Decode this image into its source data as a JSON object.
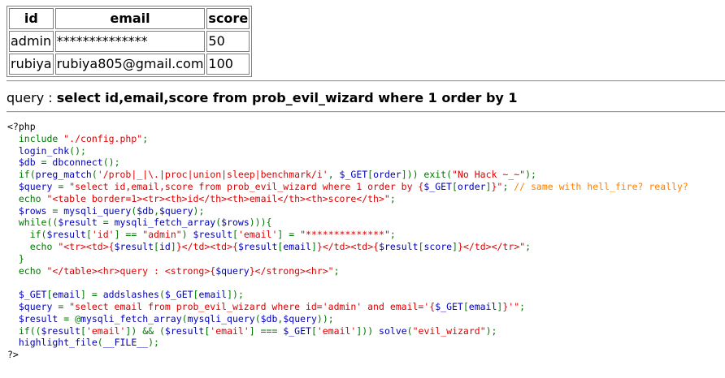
{
  "table": {
    "headers": [
      "id",
      "email",
      "score"
    ],
    "rows": [
      [
        "admin",
        "**************",
        "50"
      ],
      [
        "rubiya",
        "rubiya805@gmail.com",
        "100"
      ]
    ]
  },
  "query": {
    "label": "query : ",
    "text": "select id,email,score from prob_evil_wizard where 1 order by 1"
  },
  "colors": {
    "default": "#0000BB",
    "keyword": "#007700",
    "string": "#DD0000",
    "comment": "#FF8000",
    "html": "#000000"
  },
  "source_lines": [
    [
      [
        "html",
        "<?php"
      ]
    ],
    [
      [
        "default",
        "  "
      ],
      [
        "kw",
        "include "
      ],
      [
        "str",
        "\"./config.php\""
      ],
      [
        "kw",
        ";"
      ]
    ],
    [
      [
        "default",
        "  login_chk"
      ],
      [
        "kw",
        "();"
      ]
    ],
    [
      [
        "default",
        "  $db "
      ],
      [
        "kw",
        "= "
      ],
      [
        "default",
        "dbconnect"
      ],
      [
        "kw",
        "();"
      ]
    ],
    [
      [
        "kw",
        "  if("
      ],
      [
        "default",
        "preg_match"
      ],
      [
        "kw",
        "("
      ],
      [
        "str",
        "'/prob|_|\\.|proc|union|sleep|benchmark/i'"
      ],
      [
        "kw",
        ", "
      ],
      [
        "default",
        "$_GET"
      ],
      [
        "kw",
        "["
      ],
      [
        "default",
        "order"
      ],
      [
        "kw",
        "])) exit("
      ],
      [
        "str",
        "\"No Hack ~_~\""
      ],
      [
        "kw",
        ");"
      ]
    ],
    [
      [
        "default",
        "  $query "
      ],
      [
        "kw",
        "= "
      ],
      [
        "str",
        "\"select id,email,score from prob_evil_wizard where 1 order by {"
      ],
      [
        "default",
        "$_GET"
      ],
      [
        "kw",
        "["
      ],
      [
        "default",
        "order"
      ],
      [
        "kw",
        "]"
      ],
      [
        "str",
        "}\""
      ],
      [
        "kw",
        "; "
      ],
      [
        "cmt",
        "// same with hell_fire? really?"
      ]
    ],
    [
      [
        "kw",
        "  echo "
      ],
      [
        "str",
        "\"<table border=1><tr><th>id</th><th>email</th><th>score</th>\""
      ],
      [
        "kw",
        ";"
      ]
    ],
    [
      [
        "default",
        "  $rows "
      ],
      [
        "kw",
        "= "
      ],
      [
        "default",
        "mysqli_query"
      ],
      [
        "kw",
        "("
      ],
      [
        "default",
        "$db"
      ],
      [
        "kw",
        ","
      ],
      [
        "default",
        "$query"
      ],
      [
        "kw",
        ");"
      ]
    ],
    [
      [
        "kw",
        "  while(("
      ],
      [
        "default",
        "$result "
      ],
      [
        "kw",
        "= "
      ],
      [
        "default",
        "mysqli_fetch_array"
      ],
      [
        "kw",
        "("
      ],
      [
        "default",
        "$rows"
      ],
      [
        "kw",
        "))){"
      ]
    ],
    [
      [
        "kw",
        "    if("
      ],
      [
        "default",
        "$result"
      ],
      [
        "kw",
        "["
      ],
      [
        "str",
        "'id'"
      ],
      [
        "kw",
        "] == "
      ],
      [
        "str",
        "\"admin\""
      ],
      [
        "kw",
        ") "
      ],
      [
        "default",
        "$result"
      ],
      [
        "kw",
        "["
      ],
      [
        "str",
        "'email'"
      ],
      [
        "kw",
        "] = "
      ],
      [
        "str",
        "\"**************\""
      ],
      [
        "kw",
        ";"
      ]
    ],
    [
      [
        "kw",
        "    echo "
      ],
      [
        "str",
        "\"<tr><td>{"
      ],
      [
        "default",
        "$result"
      ],
      [
        "kw",
        "["
      ],
      [
        "default",
        "id"
      ],
      [
        "kw",
        "]"
      ],
      [
        "str",
        "}</td><td>{"
      ],
      [
        "default",
        "$result"
      ],
      [
        "kw",
        "["
      ],
      [
        "default",
        "email"
      ],
      [
        "kw",
        "]"
      ],
      [
        "str",
        "}</td><td>{"
      ],
      [
        "default",
        "$result"
      ],
      [
        "kw",
        "["
      ],
      [
        "default",
        "score"
      ],
      [
        "kw",
        "]"
      ],
      [
        "str",
        "}</td></tr>\""
      ],
      [
        "kw",
        ";"
      ]
    ],
    [
      [
        "kw",
        "  }"
      ]
    ],
    [
      [
        "kw",
        "  echo "
      ],
      [
        "str",
        "\"</table><hr>query : <strong>{"
      ],
      [
        "default",
        "$query"
      ],
      [
        "str",
        "}</strong><hr>\""
      ],
      [
        "kw",
        ";"
      ]
    ],
    [
      [
        "default",
        " "
      ]
    ],
    [
      [
        "default",
        "  $_GET"
      ],
      [
        "kw",
        "["
      ],
      [
        "default",
        "email"
      ],
      [
        "kw",
        "] = "
      ],
      [
        "default",
        "addslashes"
      ],
      [
        "kw",
        "("
      ],
      [
        "default",
        "$_GET"
      ],
      [
        "kw",
        "["
      ],
      [
        "default",
        "email"
      ],
      [
        "kw",
        "]);"
      ]
    ],
    [
      [
        "default",
        "  $query "
      ],
      [
        "kw",
        "= "
      ],
      [
        "str",
        "\"select email from prob_evil_wizard where id='admin' and email='{"
      ],
      [
        "default",
        "$_GET"
      ],
      [
        "kw",
        "["
      ],
      [
        "default",
        "email"
      ],
      [
        "kw",
        "]"
      ],
      [
        "str",
        "}'\""
      ],
      [
        "kw",
        ";"
      ]
    ],
    [
      [
        "default",
        "  $result "
      ],
      [
        "kw",
        "= @"
      ],
      [
        "default",
        "mysqli_fetch_array"
      ],
      [
        "kw",
        "("
      ],
      [
        "default",
        "mysqli_query"
      ],
      [
        "kw",
        "("
      ],
      [
        "default",
        "$db"
      ],
      [
        "kw",
        ","
      ],
      [
        "default",
        "$query"
      ],
      [
        "kw",
        "));"
      ]
    ],
    [
      [
        "kw",
        "  if(("
      ],
      [
        "default",
        "$result"
      ],
      [
        "kw",
        "["
      ],
      [
        "str",
        "'email'"
      ],
      [
        "kw",
        "]) && ("
      ],
      [
        "default",
        "$result"
      ],
      [
        "kw",
        "["
      ],
      [
        "str",
        "'email'"
      ],
      [
        "kw",
        "] === "
      ],
      [
        "default",
        "$_GET"
      ],
      [
        "kw",
        "["
      ],
      [
        "str",
        "'email'"
      ],
      [
        "kw",
        "])) "
      ],
      [
        "default",
        "solve"
      ],
      [
        "kw",
        "("
      ],
      [
        "str",
        "\"evil_wizard\""
      ],
      [
        "kw",
        ");"
      ]
    ],
    [
      [
        "default",
        "  highlight_file"
      ],
      [
        "kw",
        "("
      ],
      [
        "default",
        "__FILE__"
      ],
      [
        "kw",
        ");"
      ]
    ],
    [
      [
        "html",
        "?>"
      ]
    ]
  ]
}
